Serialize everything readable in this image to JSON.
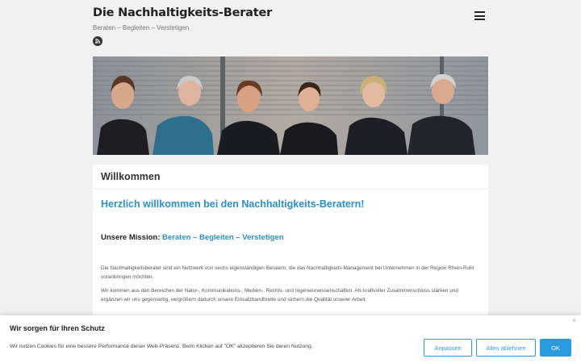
{
  "site": {
    "title": "Die Nachhaltigkeits-Berater",
    "description": "Beraten – Begleiten – Verstetigen",
    "rss_icon": "rss-icon",
    "menu_icon": "hamburger-menu-icon"
  },
  "hero": {
    "image": "team-photo"
  },
  "article": {
    "entry_title": "Willkommen",
    "welcome_heading": "Herzlich willkommen bei den Nachhaltigkeits-Beratern!",
    "mission_label": "Unsere Mission:",
    "mission_link": "Beraten – Begleiten – Verstetigen",
    "paragraph_1": "Die Nachhaltigkeitsberater sind ein Netzwerk von sechs eigenständigen Beratern, die das Nachhaltigkeits-Management bei Unternehmen in der Region Rhein-Ruhr voranbringen möchten.",
    "paragraph_2": "Wir kommen aus den Bereichen der Natur-, Kommunikations-, Medien-, Rechts- und Ingenieurwissenschaften. Als kraftvoller Zusammenschluss stärken und ergänzen wir uns gegenseitig, vergrößern dadurch unsere Einsatzbandbreite und sichern die Qualität unserer Arbeit."
  },
  "cookie": {
    "title": "Wir sorgen für Ihren Schutz",
    "text": "Wir nutzen Cookies für eine bessere Performance dieser Web-Präsenz. Beim Klicken auf \"OK\" akzeptieren Sie deren Nutzung.",
    "close_label": "×",
    "customize_label": "Anpassen",
    "reject_label": "Alles ablehnen",
    "accept_label": "OK"
  },
  "colors": {
    "accent": "#2a8fc6",
    "button": "#2b9be0",
    "background": "#f1f1f1"
  }
}
